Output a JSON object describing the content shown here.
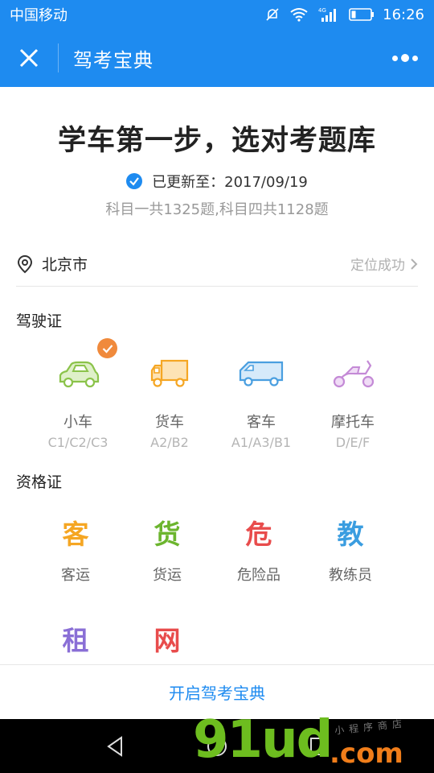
{
  "statusbar": {
    "carrier": "中国移动",
    "network": "4G",
    "time": "16:26"
  },
  "titlebar": {
    "title": "驾考宝典"
  },
  "main": {
    "headline": "学车第一步，选对考题库",
    "updated_text": "已更新至：2017/09/19",
    "counts_text": "科目一共1325题,科目四共1128题"
  },
  "location": {
    "city": "北京市",
    "status": "定位成功"
  },
  "licenses": {
    "title": "驾驶证",
    "items": [
      {
        "name": "小车",
        "code": "C1/C2/C3",
        "icon": "car-icon",
        "color": "#8bc34a",
        "selected": true
      },
      {
        "name": "货车",
        "code": "A2/B2",
        "icon": "truck-icon",
        "color": "#f5a623",
        "selected": false
      },
      {
        "name": "客车",
        "code": "A1/A3/B1",
        "icon": "bus-icon",
        "color": "#4a9fe0",
        "selected": false
      },
      {
        "name": "摩托车",
        "code": "D/E/F",
        "icon": "motorcycle-icon",
        "color": "#c48ad6",
        "selected": false
      }
    ]
  },
  "certificates": {
    "title": "资格证",
    "items": [
      {
        "glyph": "客",
        "label": "客运",
        "color": "#f5a623"
      },
      {
        "glyph": "货",
        "label": "货运",
        "color": "#6cb52e"
      },
      {
        "glyph": "危",
        "label": "危险品",
        "color": "#e84c4c"
      },
      {
        "glyph": "教",
        "label": "教练员",
        "color": "#3a9de0"
      },
      {
        "glyph": "租",
        "label": "",
        "color": "#8a6fd6"
      },
      {
        "glyph": "网",
        "label": "",
        "color": "#e84c4c"
      }
    ]
  },
  "bottom_link": {
    "label": "开启驾考宝典"
  },
  "watermark": {
    "main": "91ud",
    "suffix": ".com",
    "small": "小程序商店"
  },
  "colors": {
    "brand": "#1e8bf0",
    "badge": "#f08a3c"
  }
}
